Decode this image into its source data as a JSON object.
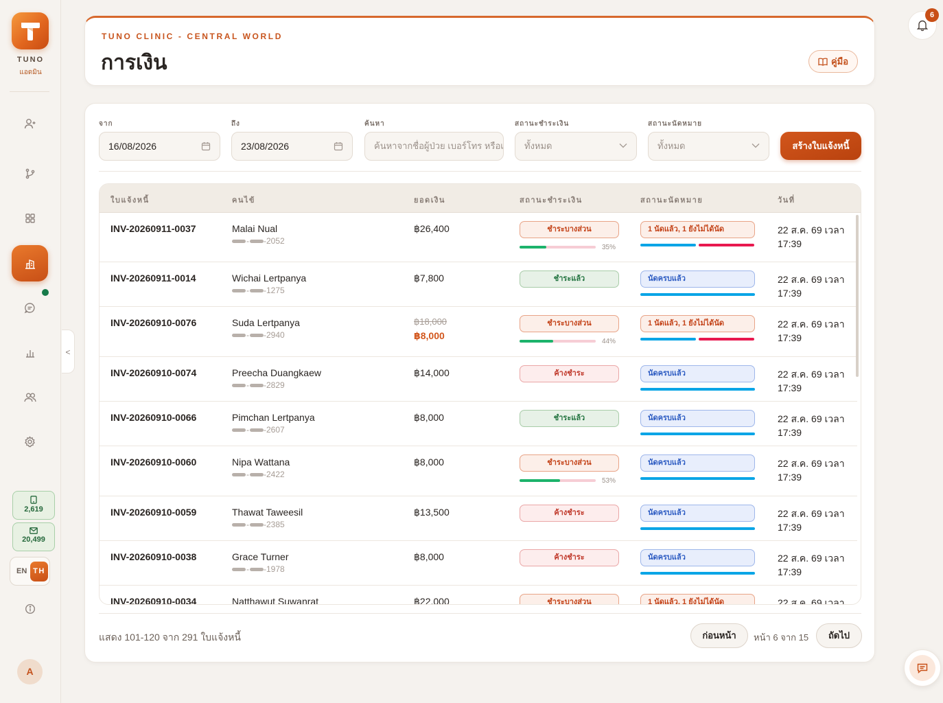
{
  "sidebar": {
    "brand": "TUNO",
    "brand_sub": "แอดมิน",
    "sms_credits": "2,619",
    "email_credits": "20,499",
    "lang_en": "EN",
    "lang_th": "TH",
    "avatar_initial": "A",
    "collapse_glyph": "<",
    "nav_icons": [
      "add-patient-icon",
      "branch-icon",
      "grid-icon",
      "finance-icon",
      "chat-icon",
      "chart-icon",
      "users-icon",
      "settings-icon",
      "info-icon"
    ]
  },
  "header": {
    "clinic": "TUNO CLINIC - CENTRAL WORLD",
    "title": "การเงิน",
    "guide_label": "คู่มือ"
  },
  "filters": {
    "from_label": "จาก",
    "from_value": "16/08/2026",
    "to_label": "ถึง",
    "to_value": "23/08/2026",
    "search_label": "ค้นหา",
    "search_placeholder": "ค้นหาจากชื่อผู้ป่วย เบอร์โทร หรือเลขใบแจ้งหนี้",
    "pay_status_label": "สถานะชำระเงิน",
    "pay_status_value": "ทั้งหมด",
    "appt_status_label": "สถานะนัดหมาย",
    "appt_status_value": "ทั้งหมด",
    "create_label": "สร้างใบแจ้งหนี้"
  },
  "table": {
    "headers": {
      "invoice": "ใบแจ้งหนี้",
      "patient": "คนไข้",
      "amount": "ยอดเงิน",
      "pay_status": "สถานะชำระเงิน",
      "appt_status": "สถานะนัดหมาย",
      "date": "วันที่"
    },
    "rows": [
      {
        "invoice": "INV-20260911-0037",
        "name": "Malai Nual",
        "phone_tail": "-2052",
        "amount": "฿26,400",
        "amount_old": "",
        "pay": "ชำระบางส่วน",
        "pay_type": "partial",
        "pay_pct": 35,
        "pay_pct_label": "35%",
        "appt": "1 นัดแล้ว, 1 ยังไม่ได้นัด",
        "appt_type": "partial",
        "date_line1": "22 ส.ค. 69 เวลา",
        "date_line2": "17:39"
      },
      {
        "invoice": "INV-20260911-0014",
        "name": "Wichai Lertpanya",
        "phone_tail": "-1275",
        "amount": "฿7,800",
        "amount_old": "",
        "pay": "ชำระแล้ว",
        "pay_type": "paid",
        "pay_pct": null,
        "pay_pct_label": "",
        "appt": "นัดครบแล้ว",
        "appt_type": "done",
        "date_line1": "22 ส.ค. 69 เวลา",
        "date_line2": "17:39"
      },
      {
        "invoice": "INV-20260910-0076",
        "name": "Suda Lertpanya",
        "phone_tail": "-2940",
        "amount": "฿8,000",
        "amount_old": "฿18,000",
        "pay": "ชำระบางส่วน",
        "pay_type": "partial",
        "pay_pct": 44,
        "pay_pct_label": "44%",
        "appt": "1 นัดแล้ว, 1 ยังไม่ได้นัด",
        "appt_type": "partial",
        "date_line1": "22 ส.ค. 69 เวลา",
        "date_line2": "17:39"
      },
      {
        "invoice": "INV-20260910-0074",
        "name": "Preecha Duangkaew",
        "phone_tail": "-2829",
        "amount": "฿14,000",
        "amount_old": "",
        "pay": "ค้างชำระ",
        "pay_type": "unpaid",
        "pay_pct": null,
        "pay_pct_label": "",
        "appt": "นัดครบแล้ว",
        "appt_type": "done",
        "date_line1": "22 ส.ค. 69 เวลา",
        "date_line2": "17:39"
      },
      {
        "invoice": "INV-20260910-0066",
        "name": "Pimchan Lertpanya",
        "phone_tail": "-2607",
        "amount": "฿8,000",
        "amount_old": "",
        "pay": "ชำระแล้ว",
        "pay_type": "paid",
        "pay_pct": null,
        "pay_pct_label": "",
        "appt": "นัดครบแล้ว",
        "appt_type": "done",
        "date_line1": "22 ส.ค. 69 เวลา",
        "date_line2": "17:39"
      },
      {
        "invoice": "INV-20260910-0060",
        "name": "Nipa Wattana",
        "phone_tail": "-2422",
        "amount": "฿8,000",
        "amount_old": "",
        "pay": "ชำระบางส่วน",
        "pay_type": "partial",
        "pay_pct": 53,
        "pay_pct_label": "53%",
        "appt": "นัดครบแล้ว",
        "appt_type": "done",
        "date_line1": "22 ส.ค. 69 เวลา",
        "date_line2": "17:39"
      },
      {
        "invoice": "INV-20260910-0059",
        "name": "Thawat Taweesil",
        "phone_tail": "-2385",
        "amount": "฿13,500",
        "amount_old": "",
        "pay": "ค้างชำระ",
        "pay_type": "unpaid",
        "pay_pct": null,
        "pay_pct_label": "",
        "appt": "นัดครบแล้ว",
        "appt_type": "done",
        "date_line1": "22 ส.ค. 69 เวลา",
        "date_line2": "17:39"
      },
      {
        "invoice": "INV-20260910-0038",
        "name": "Grace Turner",
        "phone_tail": "-1978",
        "amount": "฿8,000",
        "amount_old": "",
        "pay": "ค้างชำระ",
        "pay_type": "unpaid",
        "pay_pct": null,
        "pay_pct_label": "",
        "appt": "นัดครบแล้ว",
        "appt_type": "done",
        "date_line1": "22 ส.ค. 69 เวลา",
        "date_line2": "17:39"
      },
      {
        "invoice": "INV-20260910-0034",
        "name": "Natthawut Suwanrat",
        "phone_tail": "",
        "amount": "฿22,000",
        "amount_old": "",
        "pay": "ชำระบางส่วน",
        "pay_type": "partial",
        "pay_pct": null,
        "pay_pct_label": "",
        "appt": "1 นัดแล้ว, 1 ยังไม่ได้นัด",
        "appt_type": "partial",
        "date_line1": "22 ส.ค. 69 เวลา",
        "date_line2": ""
      }
    ]
  },
  "footer": {
    "showing": "แสดง 101-120 จาก 291 ใบแจ้งหนี้",
    "prev_label": "ก่อนหน้า",
    "page_info": "หน้า 6 จาก 15",
    "next_label": "ถัดไป"
  },
  "notifications": {
    "count": "6"
  },
  "colors": {
    "accent": "#c84f16",
    "paid_bar": "#1cb36b",
    "unpaid_bar": "#f6cdd5",
    "appt_done": "#0aa5e6",
    "appt_pending": "#e8194f"
  }
}
